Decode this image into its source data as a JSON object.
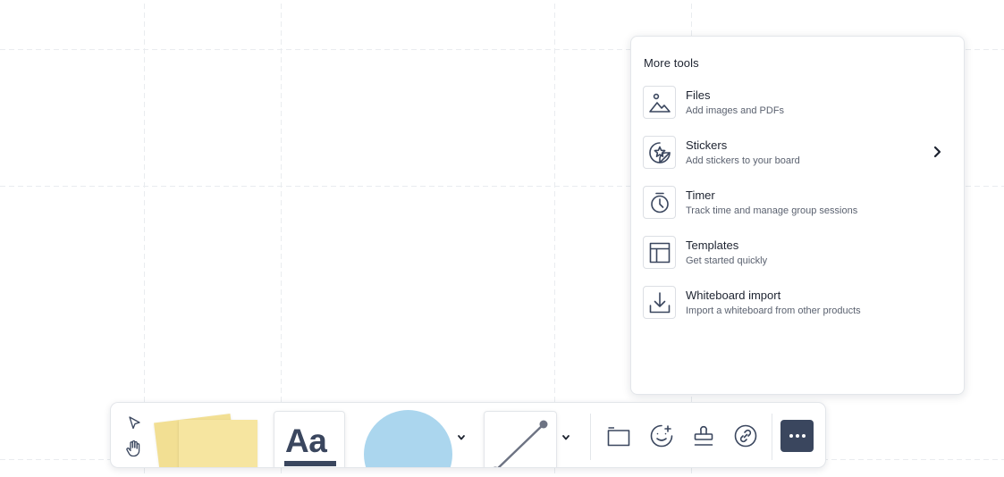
{
  "more_tools": {
    "title": "More tools",
    "items": [
      {
        "name": "Files",
        "description": "Add images and PDFs",
        "icon": "image-icon",
        "has_submenu": false
      },
      {
        "name": "Stickers",
        "description": "Add stickers to your board",
        "icon": "sticker-icon",
        "has_submenu": true
      },
      {
        "name": "Timer",
        "description": "Track time and manage group sessions",
        "icon": "timer-icon",
        "has_submenu": false
      },
      {
        "name": "Templates",
        "description": "Get started quickly",
        "icon": "template-icon",
        "has_submenu": false
      },
      {
        "name": "Whiteboard import",
        "description": "Import a whiteboard from other products",
        "icon": "import-icon",
        "has_submenu": false
      }
    ]
  },
  "toolbar": {
    "text_tool_label": "Aa",
    "tools": [
      "select-icon",
      "hand-icon",
      "sticky-note-icon",
      "text-icon",
      "shape-icon",
      "line-icon",
      "frame-icon",
      "reaction-icon",
      "stamp-icon",
      "link-icon",
      "more-icon"
    ]
  },
  "colors": {
    "sticky_note": "#f6e5a0",
    "shape_fill": "#abd6ee",
    "icon": "#3a465e",
    "more_button": "#3a465e"
  }
}
